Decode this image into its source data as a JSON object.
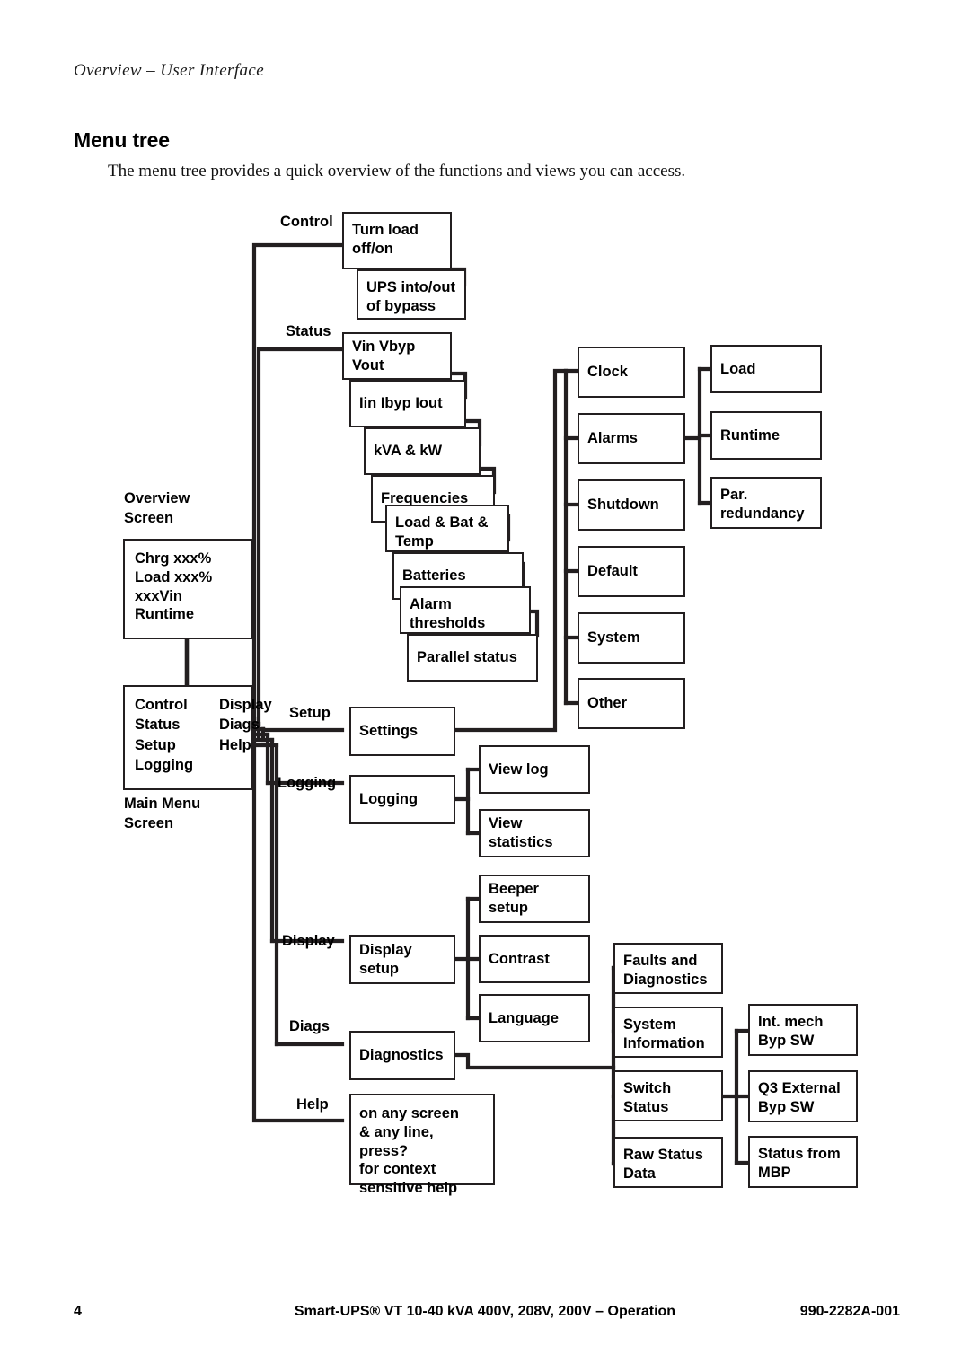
{
  "page": {
    "running_header": "Overview – User Interface",
    "heading": "Menu tree",
    "intro": "The menu tree provides a quick overview of the functions and views you can access.",
    "footer_page_number": "4",
    "footer_center": "Smart-UPS® VT 10-40 kVA 400V, 208V, 200V – Operation",
    "footer_doc_id": "990-2282A-001",
    "line_color": "#231f20"
  },
  "diagram": {
    "screens": {
      "overview_caption": "Overview\nScreen",
      "overview_lines": [
        "Chrg xxx%",
        "Load xxx%",
        "xxxVin",
        "Runtime"
      ],
      "main_menu_caption": "Main Menu\nScreen",
      "main_menu_items_left": [
        "Control",
        "Status",
        "Setup",
        "Logging"
      ],
      "main_menu_items_right": [
        "Display",
        "Diags",
        "Help"
      ]
    },
    "branch_labels": {
      "control": "Control",
      "status": "Status",
      "setup": "Setup",
      "logging": "Logging",
      "display": "Display",
      "diags": "Diags",
      "help": "Help"
    },
    "control_items": [
      "Turn load\noff/on",
      "UPS into/out\nof bypass"
    ],
    "status_items": [
      "Vin Vbyp Vout",
      "Iin Ibyp Iout",
      "kVA & kW",
      "Frequencies",
      "Load & Bat &\nTemp",
      "Batteries",
      "Alarm\nthresholds",
      "Parallel status"
    ],
    "setup_node": "Settings",
    "settings_items": [
      "Clock",
      "Alarms",
      "Shutdown",
      "Default",
      "System",
      "Other"
    ],
    "alarms_items": [
      "Load",
      "Runtime",
      "Par.\nredundancy"
    ],
    "logging_node": "Logging",
    "logging_items": [
      "View log",
      "View statistics"
    ],
    "display_node": "Display setup",
    "display_items": [
      "Beeper setup",
      "Contrast",
      "Language"
    ],
    "diags_node": "Diagnostics",
    "diags_items": [
      "Faults and\nDiagnostics",
      "System\nInformation",
      "Switch\nStatus",
      "Raw Status\nData"
    ],
    "switch_status_items": [
      "Int. mech\nByp SW",
      "Q3 External\nByp SW",
      "Status from\nMBP"
    ],
    "help_node": "on any screen\n& any line, press?\nfor context\nsensitive help"
  }
}
